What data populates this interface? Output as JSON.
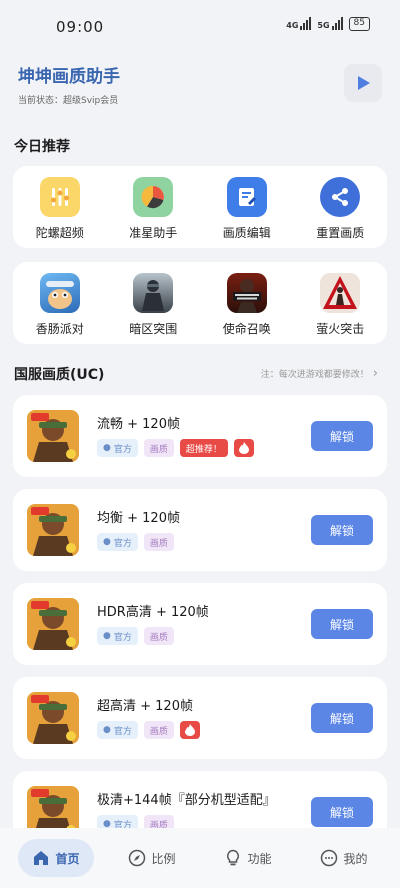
{
  "status_bar": {
    "time": "09:00",
    "net1": "4G",
    "net2": "5G",
    "battery": "85"
  },
  "header": {
    "title": "坤坤画质助手",
    "status": "当前状态：超级Svip会员"
  },
  "today": {
    "title": "今日推荐",
    "tools": [
      {
        "label": "陀螺超频",
        "icon": "gyro-icon"
      },
      {
        "label": "准星助手",
        "icon": "crosshair-icon"
      },
      {
        "label": "画质编辑",
        "icon": "edit-icon"
      },
      {
        "label": "重置画质",
        "icon": "share-reset-icon"
      }
    ],
    "games": [
      {
        "label": "香肠派对",
        "icon": "sausage-party-icon"
      },
      {
        "label": "暗区突围",
        "icon": "arena-breakout-icon"
      },
      {
        "label": "使命召唤",
        "icon": "call-of-duty-icon"
      },
      {
        "label": "萤火突击",
        "icon": "firefly-icon"
      }
    ]
  },
  "server": {
    "title": "国服画质(UC)",
    "note": "注：每次进游戏都要修改！",
    "items": [
      {
        "title": "流畅 + 120帧",
        "tag_official": "官方",
        "tag_quality": "画质",
        "tag_hot": "超推荐！",
        "has_fire": true,
        "button": "解锁"
      },
      {
        "title": "均衡 + 120帧",
        "tag_official": "官方",
        "tag_quality": "画质",
        "tag_hot": "",
        "has_fire": false,
        "button": "解锁"
      },
      {
        "title": "HDR高清 + 120帧",
        "tag_official": "官方",
        "tag_quality": "画质",
        "tag_hot": "",
        "has_fire": false,
        "button": "解锁"
      },
      {
        "title": "超高清 + 120帧",
        "tag_official": "官方",
        "tag_quality": "画质",
        "tag_hot": "",
        "has_fire": true,
        "button": "解锁"
      },
      {
        "title": "极清+144帧『部分机型适配』",
        "tag_official": "官方",
        "tag_quality": "画质",
        "tag_hot": "",
        "has_fire": false,
        "button": "解锁"
      }
    ]
  },
  "nav": [
    {
      "label": "首页",
      "icon": "home-icon",
      "active": true
    },
    {
      "label": "比例",
      "icon": "compass-icon",
      "active": false
    },
    {
      "label": "功能",
      "icon": "bulb-icon",
      "active": false
    },
    {
      "label": "我的",
      "icon": "chat-icon",
      "active": false
    }
  ],
  "colors": {
    "accent": "#5b86e5",
    "title": "#3a66b0",
    "hot": "#e84a45"
  }
}
